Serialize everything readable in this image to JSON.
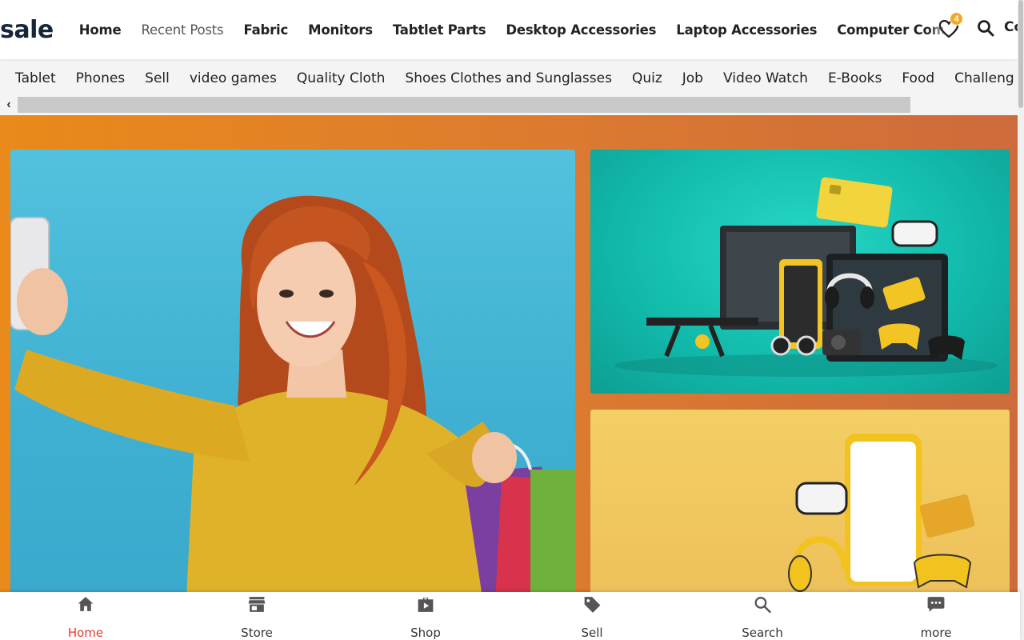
{
  "header": {
    "logo": "sale",
    "nav": [
      {
        "label": "Home",
        "muted": false
      },
      {
        "label": "Recent Posts",
        "muted": true
      },
      {
        "label": "Fabric",
        "muted": false
      },
      {
        "label": "Monitors",
        "muted": false
      },
      {
        "label": "Tabtlet Parts",
        "muted": false
      },
      {
        "label": "Desktop Accessories",
        "muted": false
      },
      {
        "label": "Laptop Accessories",
        "muted": false
      },
      {
        "label": "Computer Comp",
        "muted": false
      }
    ],
    "wishlist_count": "4",
    "clipped_item": "Co",
    "icons": {
      "wishlist": "heart-icon",
      "search": "search-icon"
    }
  },
  "categories": [
    "Tablet",
    "Phones",
    "Sell",
    "video games",
    "Quality Cloth",
    "Shoes Clothes and Sunglasses",
    "Quiz",
    "Job",
    "Video Watch",
    "E-Books",
    "Food",
    "Challeng"
  ],
  "scroll": {
    "left_arrow": "‹"
  },
  "bottom_nav": [
    {
      "label": "Home",
      "icon": "home-icon",
      "active": true
    },
    {
      "label": "Store",
      "icon": "store-icon",
      "active": false
    },
    {
      "label": "Shop",
      "icon": "shop-icon",
      "active": false
    },
    {
      "label": "Sell",
      "icon": "tag-icon",
      "active": false
    },
    {
      "label": "Search",
      "icon": "search-icon",
      "active": false
    },
    {
      "label": "more",
      "icon": "chat-icon",
      "active": false
    }
  ],
  "colors": {
    "accent_active": "#e43a2c",
    "badge": "#f5a623",
    "hero_orange": "#e98a1a",
    "logo": "#16253a"
  }
}
